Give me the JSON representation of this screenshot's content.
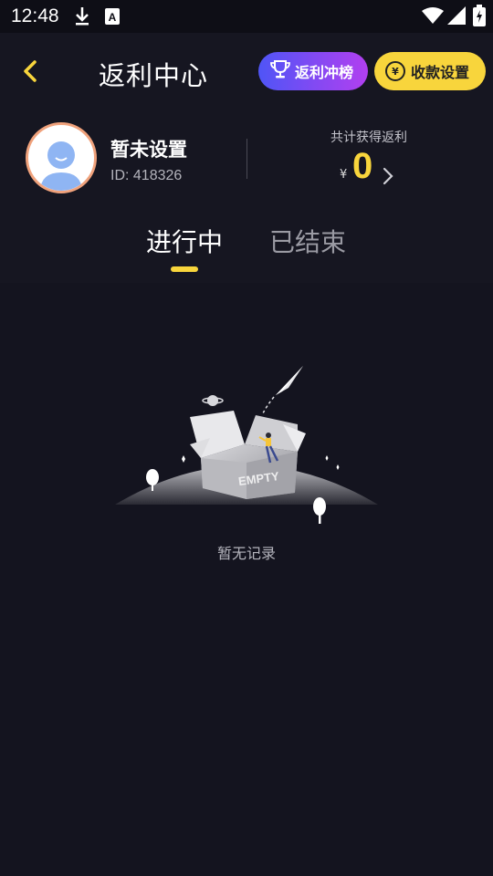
{
  "status_bar": {
    "time": "12:48",
    "icons": [
      "download-icon",
      "a-badge-icon",
      "wifi-icon",
      "signal-icon",
      "battery-icon"
    ]
  },
  "header": {
    "title": "返利中心",
    "rank_button_label": "返利冲榜",
    "payment_button_label": "收款设置",
    "payment_button_symbol": "¥"
  },
  "profile": {
    "name": "暂未设置",
    "id_text": "ID: 418326",
    "total_label": "共计获得返利",
    "currency": "¥",
    "total_value": "0"
  },
  "tabs": [
    {
      "label": "进行中",
      "active": true
    },
    {
      "label": "已结束",
      "active": false
    }
  ],
  "empty_state": {
    "box_text": "EMPTY",
    "message": "暂无记录"
  },
  "colors": {
    "background": "#14141f",
    "accent_yellow": "#f8d53c",
    "rank_gradient_start": "#4f55f6",
    "rank_gradient_end": "#b23ff0"
  }
}
